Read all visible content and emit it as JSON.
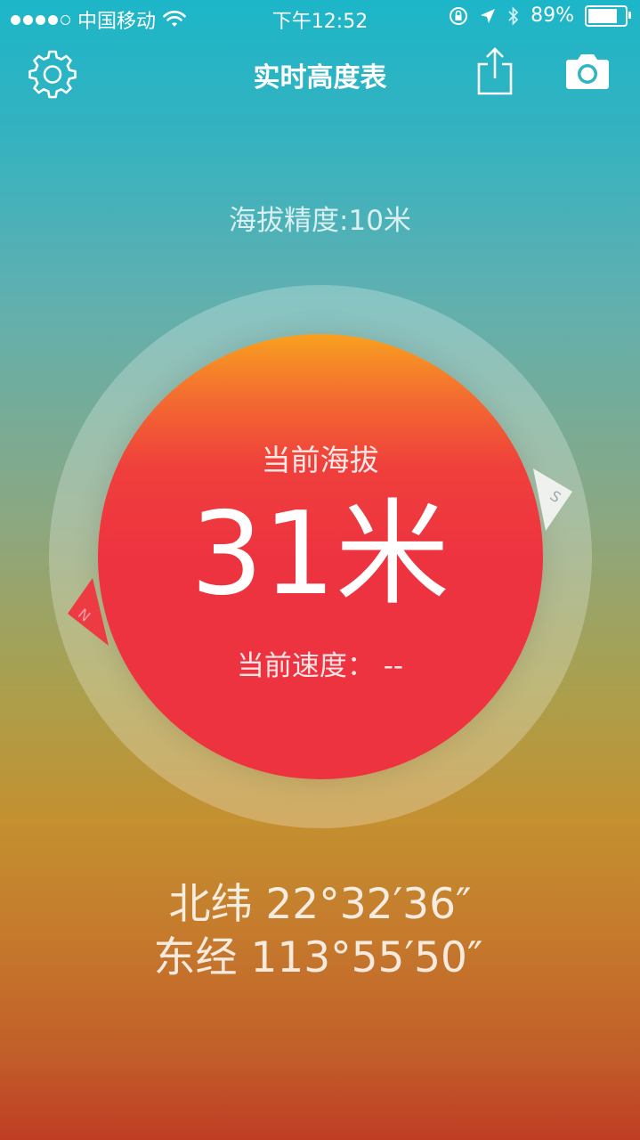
{
  "status_bar": {
    "signal_full": 4,
    "signal_total": 5,
    "carrier": "中国移动",
    "time": "下午12:52",
    "battery_text": "89%",
    "battery_level": 0.89
  },
  "nav": {
    "title": "实时高度表",
    "icons": [
      "gear-icon",
      "share-icon",
      "camera-icon"
    ]
  },
  "precision_text": "海拔精度:10米",
  "altimeter": {
    "label": "当前海拔",
    "altitude_text": "31米",
    "speed_text": "当前速度： --",
    "compass_s": "S",
    "compass_n": "N"
  },
  "coordinates": {
    "latitude": "北纬 22°32′36″",
    "longitude": "东经 113°55′50″"
  },
  "colors": {
    "top": "#1cb6c8",
    "bottom": "#bf3d25",
    "core_red": "#ee3340",
    "core_orange": "#f8a120"
  }
}
